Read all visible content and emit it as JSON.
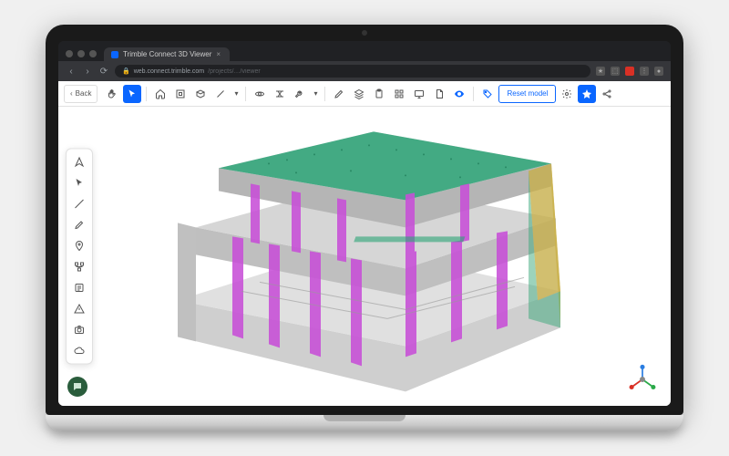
{
  "browser": {
    "tab_title": "Trimble Connect 3D Viewer",
    "url_host": "web.connect.trimble.com",
    "url_path": "/projects/…/viewer"
  },
  "toolbar": {
    "back_label": "Back",
    "reset_label": "Reset model"
  },
  "icons": {
    "hand": "hand-icon",
    "cursor": "cursor-icon",
    "home": "home-icon",
    "fit": "fit-to-view-icon",
    "section": "section-box-icon",
    "measure": "measure-icon",
    "orbit": "orbit-icon",
    "clip": "clip-plane-icon",
    "tools": "tools-icon",
    "markup": "markup-icon",
    "layers": "layers-icon",
    "clipboard": "clipboard-icon",
    "grid": "grid-icon",
    "presentation": "presentation-icon",
    "doc": "document-icon",
    "visibility": "visibility-icon",
    "tag": "tag-icon",
    "settings": "settings-icon",
    "share": "share-icon",
    "favorite": "favorite-icon"
  },
  "palette": [
    "navigate-icon",
    "select-icon",
    "measure-distance-icon",
    "markup-pen-icon",
    "issue-pin-icon",
    "model-tree-icon",
    "properties-icon",
    "clash-icon",
    "camera-icon",
    "cloud-sync-icon"
  ],
  "footer": {
    "chat_badge": "help-chat-icon",
    "axes": "axes-gizmo"
  },
  "colors": {
    "accent": "#0a66ff",
    "column": "#c84fd8",
    "roof": "#2aa375",
    "panel": "#d8c05a"
  }
}
